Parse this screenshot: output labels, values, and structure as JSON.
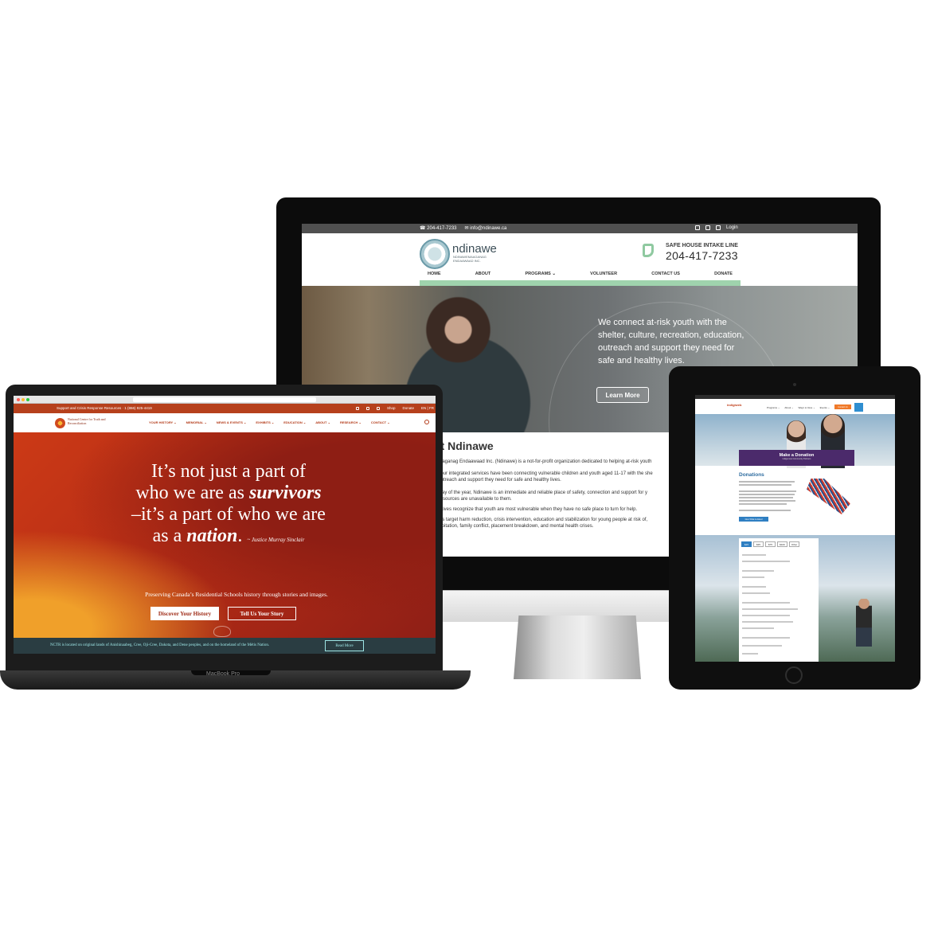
{
  "desktop": {
    "topbar": {
      "phone": "204-417-7233",
      "email": "info@ndinawe.ca",
      "login": "Login",
      "icons": [
        "instagram-icon",
        "facebook-icon",
        "twitter-icon"
      ]
    },
    "logo": {
      "name": "ndinawe",
      "subtitle": "NDINAWEMAAGANAG ENDAAWAAD INC."
    },
    "intake": {
      "label": "SAFE HOUSE INTAKE LINE",
      "number": "204-417-7233"
    },
    "nav": [
      "HOME",
      "ABOUT",
      "PROGRAMS ⌄",
      "VOLUNTEER",
      "CONTACT US",
      "DONATE"
    ],
    "hero": {
      "text": "We connect at-risk youth with the shelter, culture, recreation, education, outreach and support they need for safe and healthy lives.",
      "button": "Learn More"
    },
    "about": {
      "title": "ut Ndinawe",
      "lines": [
        "maaganag Endaawaad Inc. (Ndinawe) is a not-for-profit organization dedicated to helping at-risk youth",
        "s, our integrated services have been connecting vulnerable children and youth aged 11-17 with the she",
        ", outreach and support they need for safe and healthy lives.",
        "y day of the year, Ndinawe is an immediate and reliable place of safety, connection and support for y",
        "r resources are unavailable to them.",
        "itiatives recognize that youth are most vulnerable when they have no safe place to turn for help.",
        "ams target harm reduction, crisis intervention, education and stabilization for young people at risk of,",
        "xploitation, family conflict, placement breakdown, and mental health crises."
      ]
    }
  },
  "laptop": {
    "label": "MacBook Pro",
    "topbar": {
      "left": "Support and Crisis Response Resources · 1 (866) 925-4419",
      "shop": "Shop",
      "donate": "Donate",
      "lang": "EN | FR"
    },
    "logo": "National Centre for Truth and Reconciliation",
    "nav": [
      "YOUR HISTORY ⌄",
      "MEMORIAL ⌄",
      "NEWS & EVENTS ⌄",
      "EXHIBITS ⌄",
      "EDUCATION ⌄",
      "ABOUT ⌄",
      "RESEARCH ⌄",
      "CONTACT ⌄"
    ],
    "quote": {
      "l1": "It’s not just a part of",
      "l2a": "who we are as ",
      "l2b": "survivors",
      "l3": "–it’s a part of who we are",
      "l4a": "as a ",
      "l4b": "nation",
      "l4c": ". ",
      "author": "~ Justice Murray Sinclair"
    },
    "subtitle": "Preserving Canada’s Residential Schools history through stories and images.",
    "button_primary": "Discover Your History",
    "button_secondary": "Tell Us Your Story",
    "footer_text": "NCTR is located on original lands of Anishinaabeg, Cree, Oji-Cree, Dakota, and Dene peoples, and on the homeland of the Métis Nation.",
    "footer_button": "Read More"
  },
  "tablet": {
    "logo": "indigiweb",
    "cta": "Contact Us",
    "nav": [
      "Programs ⌄",
      "About ⌄",
      "Ways to Give ⌄",
      "Events ⌄",
      "Get Involved ⌄"
    ],
    "banner_title": "Make a Donation",
    "banner_sub": "Indigenous Community Partners",
    "donations_title": "Donations",
    "donate_button": "Give What is Asked",
    "amounts": [
      "$15",
      "$35",
      "$75",
      "$100",
      "Other"
    ]
  },
  "colors": {
    "ndinawe_green": "#9fd3ad",
    "nctr_red": "#b6401c",
    "nctr_footer": "#2a3d42",
    "indigiweb_purple": "#4b2a6b",
    "indigiweb_blue": "#2f7fc2"
  }
}
